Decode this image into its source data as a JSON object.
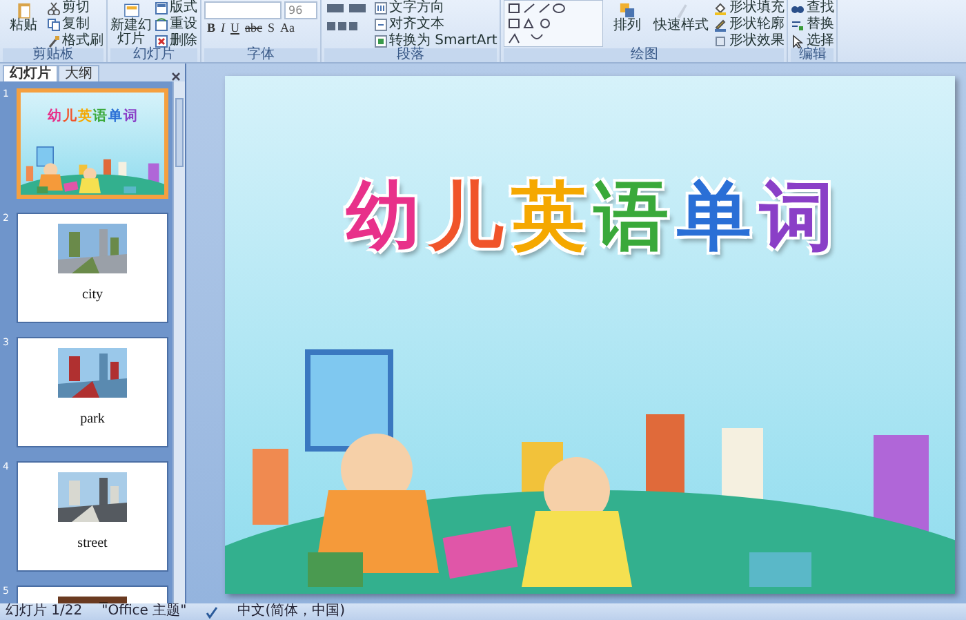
{
  "ribbon": {
    "clipboard": {
      "label": "剪贴板",
      "paste": "粘贴",
      "items": [
        {
          "kind": "cut",
          "label": "剪切"
        },
        {
          "kind": "copy",
          "label": "复制"
        },
        {
          "kind": "brush",
          "label": "格式刷"
        }
      ]
    },
    "slides": {
      "label": "幻灯片",
      "new_slide": "新建幻灯片",
      "items": [
        {
          "kind": "layout",
          "label": "版式"
        },
        {
          "kind": "reset",
          "label": "重设"
        },
        {
          "kind": "delete",
          "label": "删除"
        }
      ]
    },
    "font": {
      "label": "字体",
      "font_size": "96",
      "format_buttons": [
        "B",
        "I",
        "U",
        "abc",
        "S",
        "Aa"
      ]
    },
    "paragraph": {
      "label": "段落",
      "items": [
        {
          "kind": "direction",
          "label": "文字方向"
        },
        {
          "kind": "align",
          "label": "对齐文本"
        },
        {
          "kind": "smartart",
          "label": "转换为 SmartArt"
        }
      ]
    },
    "drawing": {
      "label": "绘图",
      "arrange": "排列",
      "quick_styles": "快速样式",
      "items": [
        {
          "kind": "fill",
          "label": "形状填充"
        },
        {
          "kind": "outline",
          "label": "形状轮廓"
        },
        {
          "kind": "effect",
          "label": "形状效果"
        }
      ]
    },
    "editing": {
      "label": "编辑",
      "items": [
        {
          "kind": "find",
          "label": "查找"
        },
        {
          "kind": "replace",
          "label": "替换"
        },
        {
          "kind": "select",
          "label": "选择"
        }
      ]
    }
  },
  "sidebar": {
    "tabs": [
      {
        "label": "幻灯片",
        "selected": true
      },
      {
        "label": "大纲",
        "selected": false
      }
    ],
    "slides": [
      {
        "number": "1",
        "selected": true,
        "kind": "title",
        "title_chars": [
          {
            "char": "幼",
            "color": "#e8318a"
          },
          {
            "char": "儿",
            "color": "#f0542a"
          },
          {
            "char": "英",
            "color": "#f5a800"
          },
          {
            "char": "语",
            "color": "#3aa93a"
          },
          {
            "char": "单",
            "color": "#2a6fd6"
          },
          {
            "char": "词",
            "color": "#8a3fc7"
          }
        ]
      },
      {
        "number": "2",
        "selected": false,
        "kind": "word",
        "word": "city"
      },
      {
        "number": "3",
        "selected": false,
        "kind": "word",
        "word": "park"
      },
      {
        "number": "4",
        "selected": false,
        "kind": "word",
        "word": "street"
      },
      {
        "number": "5",
        "selected": false,
        "kind": "word"
      }
    ]
  },
  "slide": {
    "title_chars": [
      {
        "char": "幼",
        "color": "#e8318a"
      },
      {
        "char": "儿",
        "color": "#f0542a"
      },
      {
        "char": "英",
        "color": "#f5a800"
      },
      {
        "char": "语",
        "color": "#3aa93a"
      },
      {
        "char": "单",
        "color": "#2a6fd6"
      },
      {
        "char": "词",
        "color": "#8a3fc7"
      }
    ]
  },
  "status_bar": {
    "slide": "幻灯片 1/22",
    "theme": "\"Office 主题\"",
    "language": "中文(简体，中国)"
  }
}
